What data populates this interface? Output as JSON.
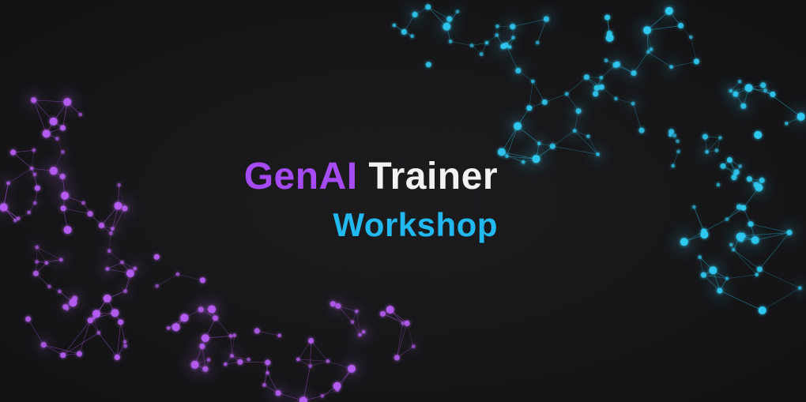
{
  "title": {
    "word1": "GenAI",
    "word2": "Trainer",
    "line2": "Workshop"
  },
  "colors": {
    "background": "#161618",
    "purple": "#a64bf4",
    "cyan": "#22b8f0",
    "white": "#f2f2f2",
    "network_left": "#b45cf0",
    "network_right": "#2ec8f0"
  }
}
